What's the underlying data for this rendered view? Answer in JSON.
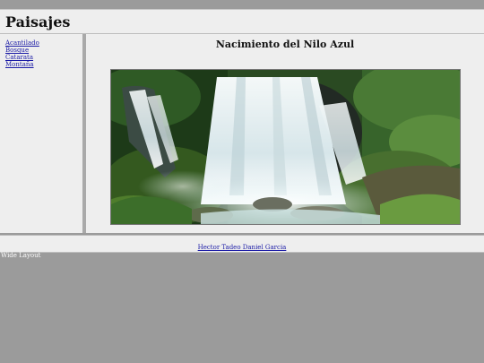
{
  "header": {
    "title": "Paisajes"
  },
  "nav": {
    "items": [
      {
        "label": "Acantilado"
      },
      {
        "label": "Bosque"
      },
      {
        "label": "Catarata"
      },
      {
        "label": "Montaña"
      }
    ]
  },
  "main": {
    "title": "Nacimiento del Nilo Azul"
  },
  "footer": {
    "author_link": "Hector Tadeo Daniel Garcia"
  },
  "layout_label": "Wide Layout"
}
